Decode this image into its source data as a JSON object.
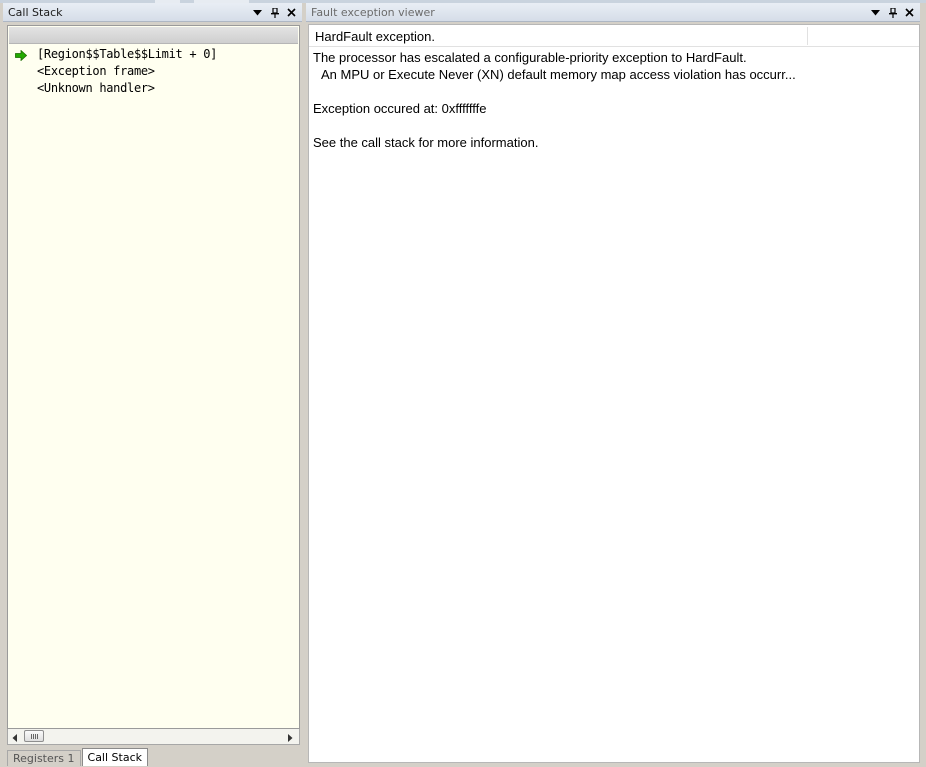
{
  "call_stack_panel": {
    "title": "Call Stack",
    "frames": [
      {
        "text": "[Region$$Table$$Limit + 0]",
        "current": true
      },
      {
        "text": "<Exception frame>",
        "current": false
      },
      {
        "text": "<Unknown handler>",
        "current": false
      }
    ],
    "tabs": [
      "Registers 1",
      "Call Stack"
    ],
    "active_tab": "Call Stack"
  },
  "fault_viewer_panel": {
    "title": "Fault exception viewer",
    "header": "HardFault exception.",
    "lines": [
      "The processor has escalated a configurable-priority exception to HardFault.",
      "An MPU or Execute Never (XN) default memory map access violation has occurr...",
      "Exception occured at: 0xfffffffe",
      "See the call stack for more information."
    ]
  },
  "colors": {
    "current_frame_arrow": "#22aa00",
    "call_stack_background": "#fffff0",
    "titlebar_top": "#e9eef5"
  },
  "icons": [
    "dropdown-arrow-icon",
    "pin-icon",
    "close-icon",
    "current-frame-arrow-icon",
    "scroll-left-icon",
    "scroll-right-icon"
  ]
}
